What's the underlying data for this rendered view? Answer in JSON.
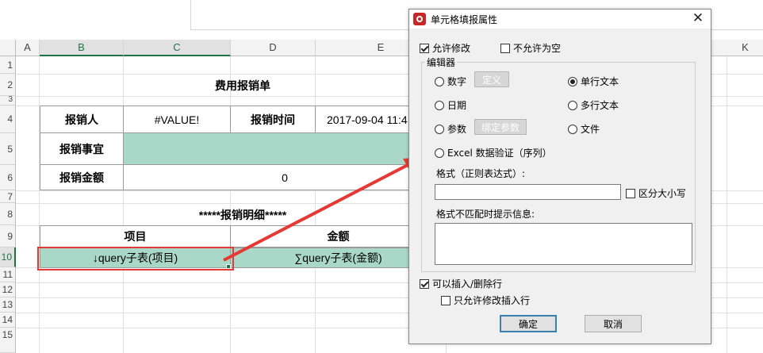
{
  "columns": [
    "A",
    "B",
    "C",
    "D",
    "E",
    "K"
  ],
  "rows": [
    "1",
    "2",
    "3",
    "4",
    "5",
    "6",
    "7",
    "8",
    "9",
    "10",
    "11",
    "12",
    "13",
    "14",
    "15"
  ],
  "sheet": {
    "title": "费用报销单",
    "reporter_label": "报销人",
    "reporter_value": "#VALUE!",
    "time_label": "报销时间",
    "time_value": "2017-09-04 11:4",
    "matter_label": "报销事宜",
    "amount_label": "报销金额",
    "amount_value": "0",
    "detail_title": "*****报销明细*****",
    "col_item": "项目",
    "col_amount": "金额",
    "item_formula": "↓query子表(项目)",
    "amount_formula": "∑query子表(金额)"
  },
  "colors": {
    "accent": "#217346",
    "fill": "#a9d8c8",
    "highlight": "#e53935"
  },
  "dialog": {
    "title": "单元格填报属性",
    "allow_edit": "允许修改",
    "not_null": "不允许为空",
    "editor_group": "编辑器",
    "number": "数字",
    "define_btn": "定义",
    "single_text": "单行文本",
    "date": "日期",
    "multi_text": "多行文本",
    "param": "参数",
    "bind_param_btn": "绑定参数",
    "file": "文件",
    "excel_validate": "Excel 数据验证（序列）",
    "format_label": "格式（正则表达式）:",
    "case_sensitive": "区分大小写",
    "mismatch_label": "格式不匹配时提示信息:",
    "allow_insert_delete": "可以插入/删除行",
    "only_edit_inserted": "只允许修改插入行",
    "ok": "确定",
    "cancel": "取消",
    "icons": [
      "app-icon",
      "close-icon"
    ]
  }
}
